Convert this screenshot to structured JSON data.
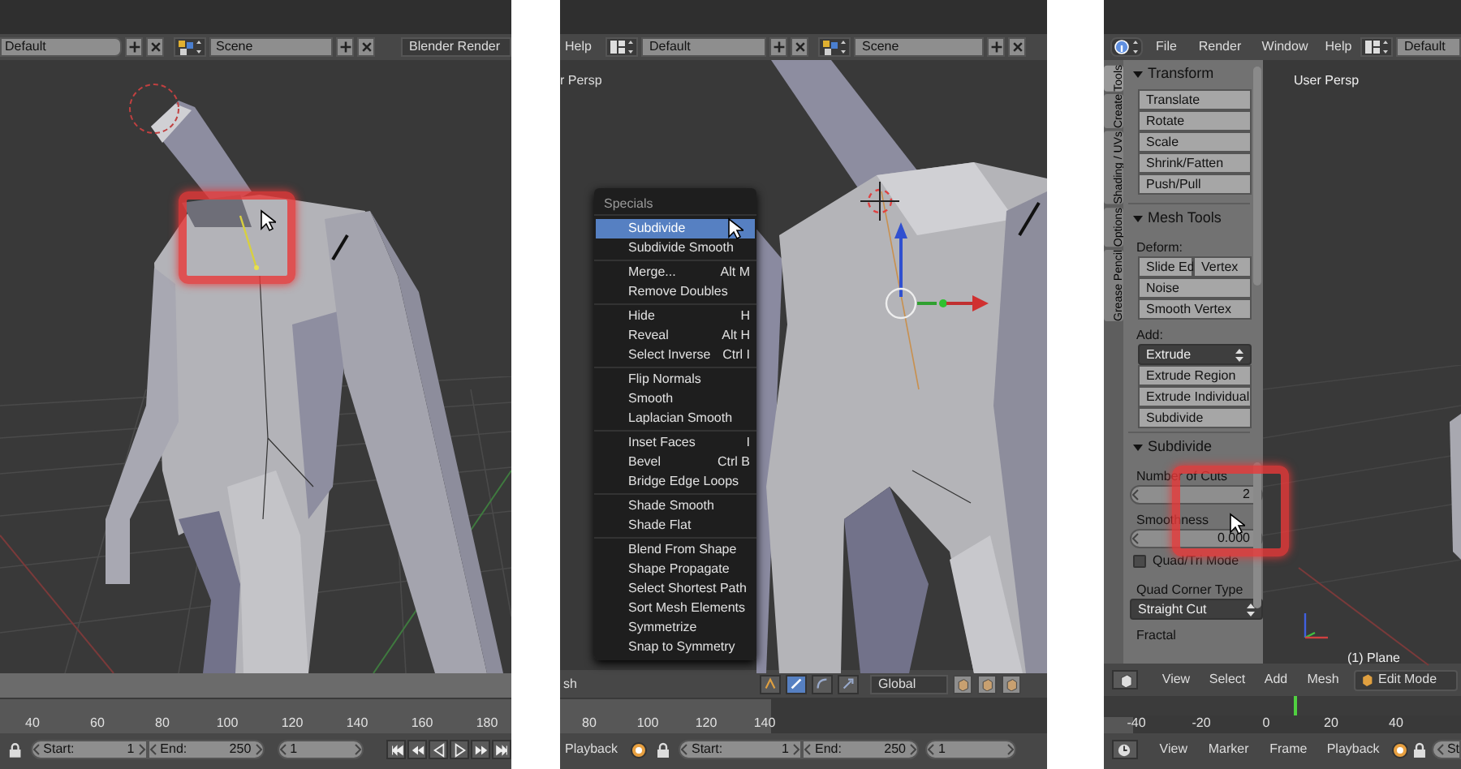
{
  "left_view": {
    "header": {
      "layout": "Default",
      "scene": "Scene",
      "render_engine": "Blender Render"
    },
    "timeline": {
      "ticks": [
        "40",
        "60",
        "80",
        "100",
        "120",
        "140",
        "160",
        "180"
      ]
    },
    "footer": {
      "start_label": "Start:",
      "start": "1",
      "end_label": "End:",
      "end": "250",
      "frame": "1"
    }
  },
  "middle_view": {
    "header": {
      "menu": "Help",
      "layout": "Default",
      "scene": "Scene"
    },
    "view_label": "r Persp",
    "specials_menu": {
      "title": "Specials",
      "groups": [
        [
          {
            "label": "Subdivide",
            "selected": true
          },
          {
            "label": "Subdivide Smooth",
            "selected": false
          }
        ],
        [
          {
            "label": "Merge...",
            "shortcut": "Alt M",
            "selected": false
          },
          {
            "label": "Remove Doubles",
            "selected": false
          }
        ],
        [
          {
            "label": "Hide",
            "shortcut": "H",
            "selected": false
          },
          {
            "label": "Reveal",
            "shortcut": "Alt H",
            "selected": false
          },
          {
            "label": "Select Inverse",
            "shortcut": "Ctrl I",
            "selected": false
          }
        ],
        [
          {
            "label": "Flip Normals",
            "selected": false
          },
          {
            "label": "Smooth",
            "selected": false
          },
          {
            "label": "Laplacian Smooth",
            "selected": false
          }
        ],
        [
          {
            "label": "Inset Faces",
            "shortcut": "I",
            "selected": false
          },
          {
            "label": "Bevel",
            "shortcut": "Ctrl B",
            "selected": false
          },
          {
            "label": "Bridge Edge Loops",
            "selected": false
          }
        ],
        [
          {
            "label": "Shade Smooth",
            "selected": false
          },
          {
            "label": "Shade Flat",
            "selected": false
          }
        ],
        [
          {
            "label": "Blend From Shape",
            "selected": false
          },
          {
            "label": "Shape Propagate",
            "selected": false
          },
          {
            "label": "Select Shortest Path",
            "selected": false
          },
          {
            "label": "Sort Mesh Elements",
            "selected": false
          },
          {
            "label": "Symmetrize",
            "selected": false
          },
          {
            "label": "Snap to Symmetry",
            "selected": false
          }
        ]
      ]
    },
    "toolbar": {
      "menu_fragment": "sh",
      "orientation": "Global"
    },
    "timeline": {
      "ticks": [
        "80",
        "100",
        "120",
        "140"
      ]
    },
    "footer": {
      "menu": "Playback",
      "start_label": "Start:",
      "start": "1",
      "end_label": "End:",
      "end": "250",
      "frame": "1"
    }
  },
  "right_view": {
    "header": {
      "menus": [
        "File",
        "Render",
        "Window",
        "Help"
      ],
      "layout": "Default"
    },
    "tool_tabs": [
      {
        "label": "Tools",
        "selected": true
      },
      {
        "label": "Create",
        "selected": false
      },
      {
        "label": "Shading / UVs",
        "selected": false
      },
      {
        "label": "Options",
        "selected": false
      },
      {
        "label": "Grease Pencil",
        "selected": false
      }
    ],
    "tool_shelf": {
      "sections": [
        {
          "title": "Transform",
          "expanded": true,
          "rows": [
            {
              "kind": "button",
              "label": "Translate"
            },
            {
              "kind": "button",
              "label": "Rotate"
            },
            {
              "kind": "button",
              "label": "Scale"
            },
            {
              "kind": "button",
              "label": "Shrink/Fatten"
            },
            {
              "kind": "button",
              "label": "Push/Pull"
            }
          ]
        },
        {
          "title": "Mesh Tools",
          "expanded": true,
          "rows": [
            {
              "kind": "label",
              "label": "Deform:"
            },
            {
              "kind": "button_pair",
              "labels": [
                "Slide Ed",
                "Vertex"
              ]
            },
            {
              "kind": "button",
              "label": "Noise"
            },
            {
              "kind": "button",
              "label": "Smooth Vertex"
            },
            {
              "kind": "label",
              "label": "Add:"
            },
            {
              "kind": "dropdown",
              "value": "Extrude"
            },
            {
              "kind": "button",
              "label": "Extrude Region"
            },
            {
              "kind": "button",
              "label": "Extrude Individual"
            },
            {
              "kind": "button",
              "label": "Subdivide"
            }
          ]
        },
        {
          "title": "Subdivide",
          "expanded": true,
          "rows": [
            {
              "kind": "label",
              "label": "Number of Cuts"
            },
            {
              "kind": "number_field",
              "value": "2"
            },
            {
              "kind": "label",
              "label": "Smoothness"
            },
            {
              "kind": "number_field",
              "value": "0.000"
            },
            {
              "kind": "checkbox",
              "label": "Quad/Tri Mode",
              "checked": false
            },
            {
              "kind": "label",
              "label": "Quad Corner Type"
            },
            {
              "kind": "dropdown",
              "value": "Straight Cut"
            },
            {
              "kind": "label",
              "label": "Fractal"
            }
          ]
        }
      ]
    },
    "view_label": "User Persp",
    "object_label": "(1) Plane",
    "toolbar": {
      "menus": [
        "View",
        "Select",
        "Add",
        "Mesh"
      ],
      "mode": "Edit Mode"
    },
    "timeline": {
      "ticks": [
        "-40",
        "-20",
        "0",
        "20",
        "40"
      ]
    },
    "footer": {
      "menus": [
        "View",
        "Marker",
        "Frame",
        "Playback"
      ],
      "start_fragment": "St"
    }
  }
}
